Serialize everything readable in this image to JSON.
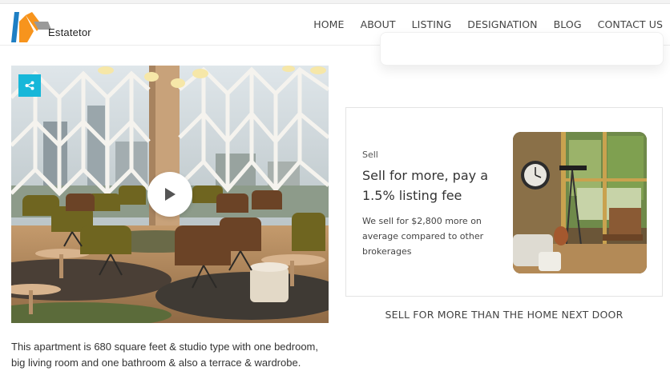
{
  "brand": {
    "name": "Estatetor",
    "colors": {
      "orange": "#f7941d",
      "blue": "#1e7fc4",
      "gray": "#8c8c8c"
    }
  },
  "nav": {
    "items": [
      {
        "label": "HOME"
      },
      {
        "label": "ABOUT"
      },
      {
        "label": "LISTING"
      },
      {
        "label": "DESIGNATION"
      },
      {
        "label": "BLOG"
      },
      {
        "label": "CONTACT US"
      }
    ]
  },
  "hero": {
    "share_icon": "share-icon",
    "play_icon": "play-icon",
    "accent": "#16b7d9"
  },
  "description": "This apartment is 680 square feet & studio type with one bedroom, big living room and one bathroom & also a terrace & wardrobe.",
  "sell": {
    "eyebrow": "Sell",
    "title": "Sell for more, pay a 1.5% listing fee",
    "body": "We sell for $2,800 more on average compared to other brokerages",
    "caption": "SELL FOR MORE THAN THE HOME NEXT DOOR"
  }
}
